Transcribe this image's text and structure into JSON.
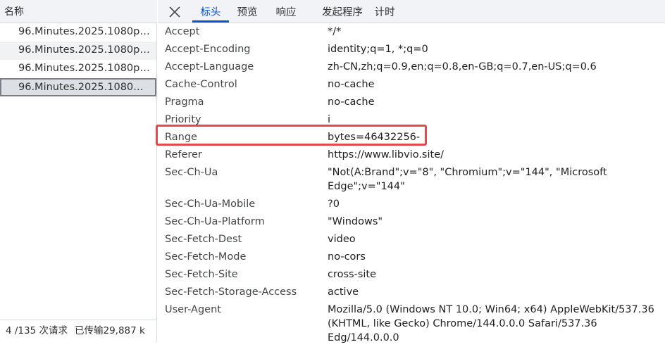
{
  "request_list": {
    "column_name": "名称",
    "rows": [
      {
        "name": "96.Minutes.2025.1080p_..."
      },
      {
        "name": "96.Minutes.2025.1080p_..."
      },
      {
        "name": "96.Minutes.2025.1080p_..."
      },
      {
        "name": "96.Minutes.2025.1080p_..."
      }
    ],
    "footer": {
      "requests": "4 /135 次请求",
      "transferred": "已传输29,887 k"
    }
  },
  "tabs": {
    "close_icon": "close-icon",
    "items": [
      {
        "label": "标头",
        "active": true
      },
      {
        "label": "预览",
        "active": false
      },
      {
        "label": "响应",
        "active": false
      },
      {
        "label": "发起程序",
        "active": false
      },
      {
        "label": "计时",
        "active": false
      }
    ]
  },
  "headers": [
    {
      "name": "Accept",
      "value": "*/*"
    },
    {
      "name": "Accept-Encoding",
      "value": "identity;q=1, *;q=0"
    },
    {
      "name": "Accept-Language",
      "value": "zh-CN,zh;q=0.9,en;q=0.8,en-GB;q=0.7,en-US;q=0.6"
    },
    {
      "name": "Cache-Control",
      "value": "no-cache"
    },
    {
      "name": "Pragma",
      "value": "no-cache"
    },
    {
      "name": "Priority",
      "value": "i"
    },
    {
      "name": "Range",
      "value": "bytes=46432256-"
    },
    {
      "name": "Referer",
      "value": "https://www.libvio.site/"
    },
    {
      "name": "Sec-Ch-Ua",
      "value": "\"Not(A:Brand\";v=\"8\", \"Chromium\";v=\"144\", \"Microsoft Edge\";v=\"144\""
    },
    {
      "name": "Sec-Ch-Ua-Mobile",
      "value": "?0"
    },
    {
      "name": "Sec-Ch-Ua-Platform",
      "value": "\"Windows\""
    },
    {
      "name": "Sec-Fetch-Dest",
      "value": "video"
    },
    {
      "name": "Sec-Fetch-Mode",
      "value": "no-cors"
    },
    {
      "name": "Sec-Fetch-Site",
      "value": "cross-site"
    },
    {
      "name": "Sec-Fetch-Storage-Access",
      "value": "active"
    },
    {
      "name": "User-Agent",
      "value": "Mozilla/5.0 (Windows NT 10.0; Win64; x64) AppleWebKit/537.36 (KHTML, like Gecko) Chrome/144.0.0.0 Safari/537.36 Edg/144.0.0.0"
    }
  ],
  "colors": {
    "accent": "#0b57d0",
    "highlight": "#e5484d"
  }
}
